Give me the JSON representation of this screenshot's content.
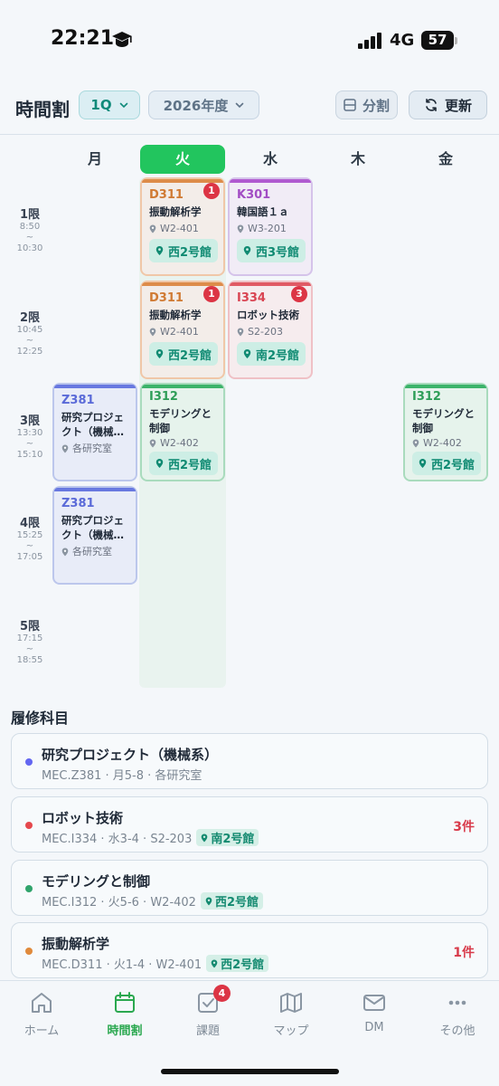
{
  "status": {
    "time": "22:21",
    "network": "4G",
    "battery": "57"
  },
  "header": {
    "title": "時間割",
    "quarter": "1Q",
    "year": "2026年度",
    "split_label": "分割",
    "refresh_label": "更新"
  },
  "days": [
    "月",
    "火",
    "水",
    "木",
    "金"
  ],
  "periods": [
    {
      "label": "1限",
      "start": "8:50",
      "sep": "~",
      "end": "10:30"
    },
    {
      "label": "2限",
      "start": "10:45",
      "sep": "~",
      "end": "12:25"
    },
    {
      "label": "3限",
      "start": "13:30",
      "sep": "~",
      "end": "15:10"
    },
    {
      "label": "4限",
      "start": "15:25",
      "sep": "~",
      "end": "17:05"
    },
    {
      "label": "5限",
      "start": "17:15",
      "sep": "~",
      "end": "18:55"
    }
  ],
  "cards": {
    "tue1": {
      "code": "D311",
      "name": "振動解析学",
      "room": "W2-401",
      "building": "西2号館",
      "badge": "1"
    },
    "wed1": {
      "code": "K301",
      "name": "韓国語１ａ",
      "room": "W3-201",
      "building": "西3号館"
    },
    "tue2": {
      "code": "D311",
      "name": "振動解析学",
      "room": "W2-401",
      "building": "西2号館",
      "badge": "1"
    },
    "wed2": {
      "code": "I334",
      "name": "ロボット技術",
      "room": "S2-203",
      "building": "南2号館",
      "badge": "3"
    },
    "mon3": {
      "code": "Z381",
      "name1": "研究プロジェ",
      "name2": "クト（機械…",
      "room": "各研究室"
    },
    "tue3": {
      "code": "I312",
      "name1": "モデリングと",
      "name2": "制御",
      "room": "W2-402",
      "building": "西2号館"
    },
    "fri3": {
      "code": "I312",
      "name1": "モデリングと",
      "name2": "制御",
      "room": "W2-402",
      "building": "西2号館"
    },
    "mon4": {
      "code": "Z381",
      "name1": "研究プロジェ",
      "name2": "クト（機械…",
      "room": "各研究室"
    }
  },
  "courses_title": "履修科目",
  "courses": [
    {
      "name": "研究プロジェクト（機械系）",
      "meta": "MEC.Z381 · 月5-8 · 各研究室",
      "building": "",
      "count": "",
      "color": "#6366f1"
    },
    {
      "name": "ロボット技術",
      "meta": "MEC.I334 · 水3-4 · S2-203",
      "building": "南2号館",
      "count": "3件",
      "color": "#e5484d"
    },
    {
      "name": "モデリングと制御",
      "meta": "MEC.I312 · 火5-6 · W2-402",
      "building": "西2号館",
      "count": "",
      "color": "#30a46c"
    },
    {
      "name": "振動解析学",
      "meta": "MEC.D311 · 火1-4 · W2-401",
      "building": "西2号館",
      "count": "1件",
      "color": "#e08a3c"
    }
  ],
  "tabs": [
    {
      "label": "ホーム",
      "icon": "home-icon"
    },
    {
      "label": "時間割",
      "icon": "calendar-icon"
    },
    {
      "label": "課題",
      "icon": "task-check-icon",
      "badge": "4"
    },
    {
      "label": "マップ",
      "icon": "map-icon"
    },
    {
      "label": "DM",
      "icon": "mail-icon"
    },
    {
      "label": "その他",
      "icon": "more-icon"
    }
  ],
  "colors": {
    "accent": "#22c55e",
    "teal": "#0f8a7a",
    "badge": "#dc3545"
  }
}
